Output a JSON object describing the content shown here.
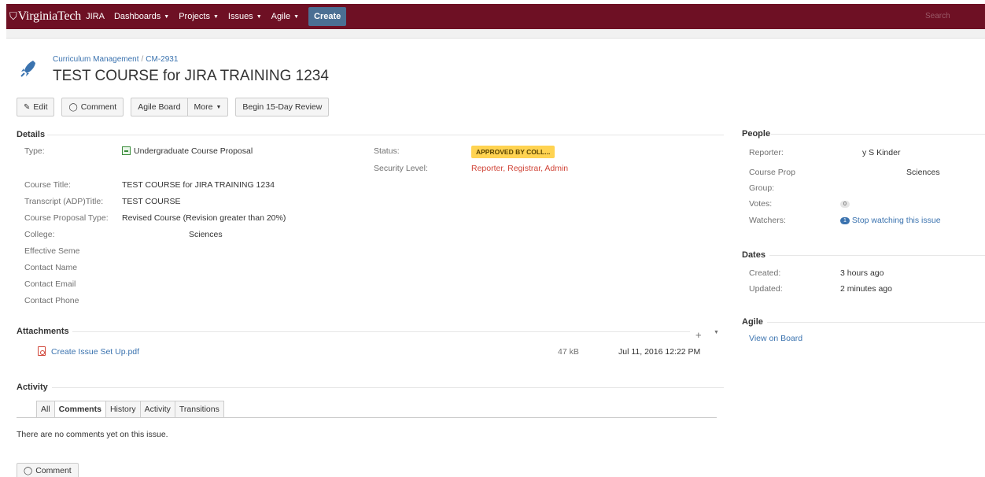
{
  "topnav": {
    "logo_text": "VirginiaTech",
    "app_name": "JIRA",
    "items": [
      {
        "label": "Dashboards"
      },
      {
        "label": "Projects"
      },
      {
        "label": "Issues"
      },
      {
        "label": "Agile"
      }
    ],
    "create_label": "Create",
    "search_placeholder": "Search",
    "bar_color": "#6e1024"
  },
  "issue": {
    "project": "Curriculum Management",
    "key": "CM-2931",
    "breadcrumb_separator": "/",
    "title": "TEST COURSE for JIRA TRAINING 1234"
  },
  "toolbar": {
    "edit": "Edit",
    "comment": "Comment",
    "agile_board": "Agile Board",
    "more": "More",
    "review": "Begin 15-Day Review"
  },
  "details": {
    "heading": "Details",
    "type_label": "Type:",
    "type_value": "Undergraduate Course Proposal",
    "status_label": "Status:",
    "status_value": "APPROVED BY COLL...",
    "security_label": "Security Level:",
    "security_value": "Reporter, Registrar, Admin",
    "fields": [
      {
        "label": "Course Title:",
        "value": "TEST COURSE for JIRA TRAINING 1234"
      },
      {
        "label": "Transcript (ADP)Title:",
        "value": "TEST COURSE"
      },
      {
        "label": "Course Proposal Type:",
        "value": "Revised Course (Revision greater than 20%)"
      },
      {
        "label": "College:",
        "value": "Sciences"
      },
      {
        "label": "Effective Seme",
        "value": ""
      },
      {
        "label": "Contact Name",
        "value": ""
      },
      {
        "label": "Contact Email",
        "value": ""
      },
      {
        "label": "Contact Phone",
        "value": ""
      }
    ]
  },
  "attachments": {
    "heading": "Attachments",
    "files": [
      {
        "name": "Create Issue Set Up.pdf",
        "size": "47 kB",
        "date": "Jul 11, 2016 12:22 PM"
      }
    ]
  },
  "activity": {
    "heading": "Activity",
    "tabs": [
      "All",
      "Comments",
      "History",
      "Activity",
      "Transitions"
    ],
    "active_tab": "Comments",
    "empty_message": "There are no comments yet on this issue.",
    "comment_button": "Comment"
  },
  "people": {
    "heading": "People",
    "reporter_label": "Reporter:",
    "reporter_value": "y S Kinder",
    "course_prop_label": "Course Prop",
    "course_prop_value": "Sciences",
    "group_label": "Group:",
    "votes_label": "Votes:",
    "votes_value": "0",
    "watchers_label": "Watchers:",
    "watchers_count": "1",
    "watchers_action": "Stop watching this issue"
  },
  "dates": {
    "heading": "Dates",
    "created_label": "Created:",
    "created_value": "3 hours ago",
    "updated_label": "Updated:",
    "updated_value": "2 minutes ago"
  },
  "agile": {
    "heading": "Agile",
    "link": "View on Board"
  }
}
